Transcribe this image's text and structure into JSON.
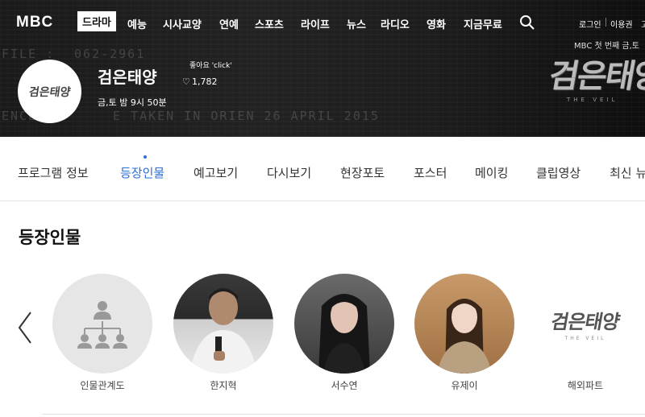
{
  "header": {
    "logo": "MBC",
    "nav": [
      "드라마",
      "예능",
      "시사교양",
      "연예",
      "스포츠",
      "라이프",
      "뉴스",
      "라디오",
      "영화",
      "지금무료"
    ],
    "util": [
      "로그인",
      "이용권",
      "고객"
    ],
    "bg_text": [
      "FILE :",
      "062-2961",
      "ENCE",
      "E TAKEN IN ORIEN 26 APRIL 2015"
    ],
    "program": {
      "logo_text": "검은태양",
      "logo_sub": "THE VEIL",
      "title": "검은태양",
      "like_label": "좋아요 'click'",
      "like_count": "1,782",
      "schedule": "금,토 밤 9시 50분"
    },
    "promo": {
      "tagline": "MBC 첫 번째 금,토",
      "title": "검은태양",
      "subtitle": "THE VEIL"
    }
  },
  "tabs": [
    "프로그램 정보",
    "등장인물",
    "예고보기",
    "다시보기",
    "현장포토",
    "포스터",
    "메이킹",
    "클립영상",
    "최신 뉴"
  ],
  "active_tab": "등장인물",
  "section": {
    "title": "등장인물"
  },
  "characters": [
    {
      "name": "인물관계도",
      "type": "diagram"
    },
    {
      "name": "한지혁",
      "type": "photo"
    },
    {
      "name": "서수연",
      "type": "photo"
    },
    {
      "name": "유제이",
      "type": "photo"
    },
    {
      "name": "해외파트",
      "type": "logo",
      "logo_text": "검은태양",
      "logo_sub": "THE VEIL"
    }
  ],
  "colors": {
    "accent": "#2c6fd6",
    "header_bg": "#1a1a1a"
  }
}
